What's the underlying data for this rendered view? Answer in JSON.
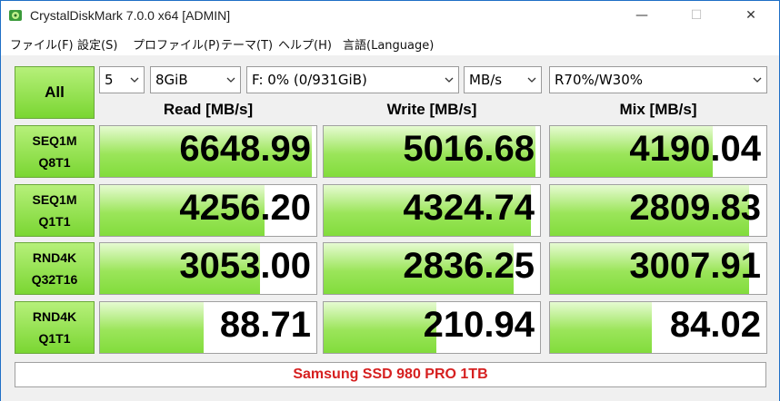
{
  "window": {
    "title": "CrystalDiskMark 7.0.0 x64 [ADMIN]",
    "minimize_glyph": "—",
    "maximize_glyph": "☐",
    "close_glyph": "✕"
  },
  "menu": {
    "items": [
      "ファイル(F)",
      "設定(S)",
      "プロファイル(P)",
      "テーマ(T)",
      "ヘルプ(H)",
      "言語(Language)"
    ]
  },
  "controls": {
    "all_label": "All",
    "count": "5",
    "size": "8GiB",
    "drive": "F: 0% (0/931GiB)",
    "unit": "MB/s",
    "mix": "R70%/W30%"
  },
  "headers": {
    "read": "Read [MB/s]",
    "write": "Write [MB/s]",
    "mix": "Mix [MB/s]"
  },
  "rows": [
    {
      "line1": "SEQ1M",
      "line2": "Q8T1",
      "read": "6648.99",
      "write": "5016.68",
      "mix": "4190.04"
    },
    {
      "line1": "SEQ1M",
      "line2": "Q1T1",
      "read": "4256.20",
      "write": "4324.74",
      "mix": "2809.83"
    },
    {
      "line1": "RND4K",
      "line2": "Q32T16",
      "read": "3053.00",
      "write": "2836.25",
      "mix": "3007.91"
    },
    {
      "line1": "RND4K",
      "line2": "Q1T1",
      "read": "88.71",
      "write": "210.94",
      "mix": "84.02"
    }
  ],
  "bar_fractions": [
    [
      0.98,
      0.98,
      0.75
    ],
    [
      0.76,
      0.96,
      0.92
    ],
    [
      0.74,
      0.88,
      0.92
    ],
    [
      0.48,
      0.52,
      0.47
    ]
  ],
  "footer": {
    "drive_name": "Samsung SSD 980 PRO 1TB"
  },
  "colors": {
    "accent_green": "#82dc3c",
    "drive_name_red": "#d62020"
  }
}
